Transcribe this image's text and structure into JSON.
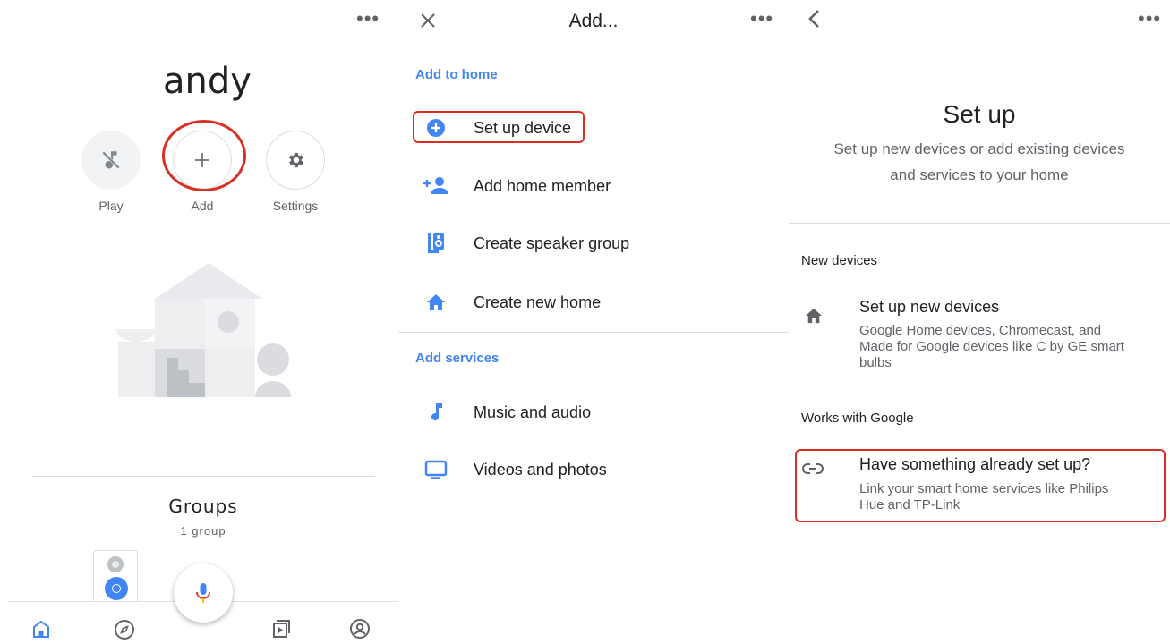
{
  "screen1": {
    "home_name": "andy",
    "actions": [
      {
        "label": "Play",
        "icon": "music-off-icon"
      },
      {
        "label": "Add",
        "icon": "plus-icon"
      },
      {
        "label": "Settings",
        "icon": "gear-icon"
      }
    ],
    "groups_title": "Groups",
    "groups_count": "1 group",
    "nav": [
      "home-icon",
      "compass-icon",
      "media-icon",
      "account-icon"
    ]
  },
  "screen2": {
    "title": "Add...",
    "section_home": "Add to home",
    "items_home": [
      {
        "label": "Set up device",
        "icon": "add-circle-icon"
      },
      {
        "label": "Add home member",
        "icon": "person-add-icon"
      },
      {
        "label": "Create speaker group",
        "icon": "speaker-icon"
      },
      {
        "label": "Create new home",
        "icon": "home-icon"
      }
    ],
    "section_services": "Add services",
    "items_services": [
      {
        "label": "Music and audio",
        "icon": "music-note-icon"
      },
      {
        "label": "Videos and photos",
        "icon": "tv-icon"
      }
    ]
  },
  "screen3": {
    "title": "Set up",
    "subtitle_line1": "Set up new devices or add existing devices",
    "subtitle_line2": "and services to your home",
    "section_new": "New devices",
    "new_title": "Set up new devices",
    "new_sub_line1": "Google Home devices, Chromecast, and",
    "new_sub_line2": "Made for Google devices like C by GE smart",
    "new_sub_line3": "bulbs",
    "section_works": "Works with Google",
    "works_title": "Have something already set up?",
    "works_sub_line1": "Link your smart home services like Philips",
    "works_sub_line2": "Hue and TP-Link"
  },
  "colors": {
    "accent": "#4285f4",
    "highlight": "#d93025",
    "mic_red": "#ea4335",
    "mic_yellow": "#fbbc04"
  },
  "overflow_glyph": "•••"
}
